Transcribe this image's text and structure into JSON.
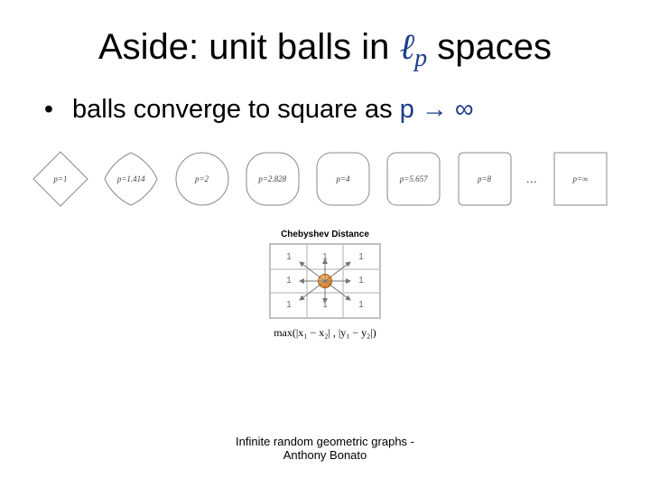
{
  "title": {
    "prefix": "Aside: unit balls in ",
    "script": "ℓ",
    "sub": "p",
    "suffix": " spaces"
  },
  "bullet": {
    "dot": "•",
    "text": "balls converge to square as ",
    "limit": "p → ∞"
  },
  "balls": {
    "labels": [
      "p=1",
      "p=1.414",
      "p=2",
      "p=2.828",
      "p=4",
      "p=5.657",
      "p=8"
    ],
    "ellipsis": "…",
    "inf": "p=∞"
  },
  "chebyshev": {
    "title": "Chebyshev Distance",
    "cells": [
      "1",
      "1",
      "1",
      "1",
      "1",
      "1",
      "1",
      "1"
    ],
    "formula_prefix": "max(",
    "formula_mid1": "|x₁ − x₂|",
    "formula_sep": " , ",
    "formula_mid2": "|y₁ − y₂|",
    "formula_suffix": ")"
  },
  "footer": {
    "line1": "Infinite random geometric graphs -",
    "line2": "Anthony Bonato"
  },
  "chart_data": {
    "type": "table",
    "title": "Chebyshev Distance",
    "categories": [
      "NW",
      "N",
      "NE",
      "W",
      "E",
      "SW",
      "S",
      "SE"
    ],
    "values": [
      1,
      1,
      1,
      1,
      1,
      1,
      1,
      1
    ]
  }
}
